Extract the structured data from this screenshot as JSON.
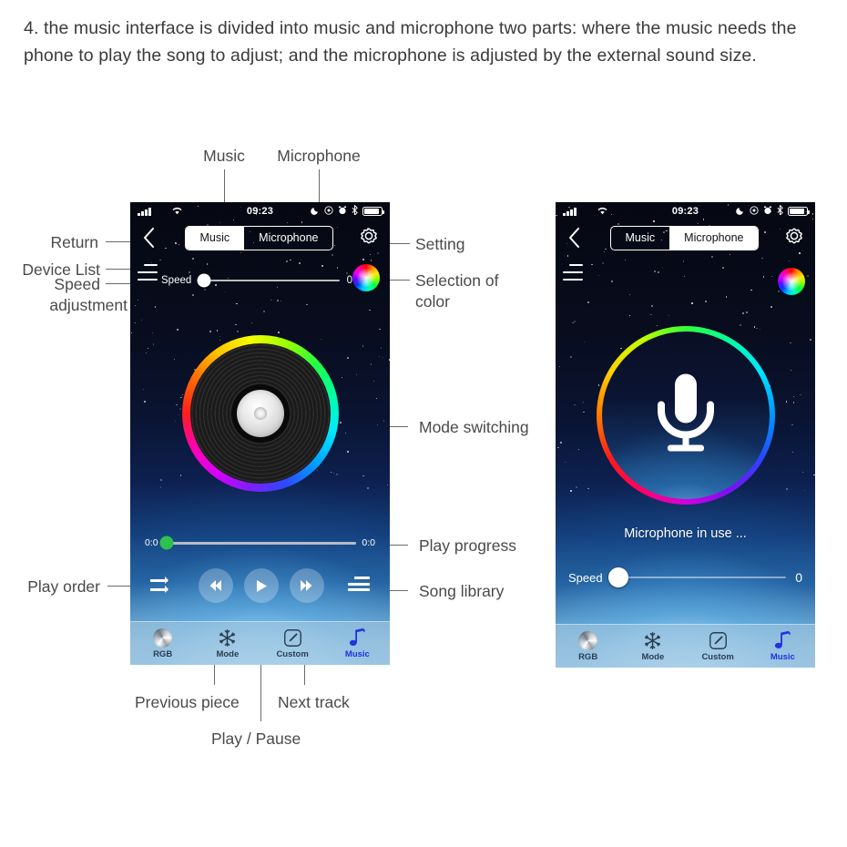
{
  "intro": {
    "text": "4. the music interface is divided into music and microphone two parts: where the music needs the phone to play the song to adjust; and the microphone is adjusted by the external sound size."
  },
  "annotations": {
    "music": "Music",
    "microphone": "Microphone",
    "return": "Return",
    "device_list": "Device List",
    "speed_adjustment_line1": "Speed",
    "speed_adjustment_line2": "adjustment",
    "setting": "Setting",
    "selection_of_color_line1": "Selection of",
    "selection_of_color_line2": "color",
    "mode_switching": "Mode switching",
    "play_progress": "Play progress",
    "play_order": "Play order",
    "song_library": "Song library",
    "previous_piece": "Previous piece",
    "next_track": "Next track",
    "play_pause": "Play / Pause"
  },
  "phone_left": {
    "status": {
      "time": "09:23",
      "icons": [
        "signal-icon",
        "wifi-icon",
        "moon-icon",
        "do-not-disturb-icon",
        "alarm-icon",
        "bluetooth-icon",
        "battery-icon"
      ]
    },
    "segmented": {
      "options": [
        "Music",
        "Microphone"
      ],
      "selected": "Music"
    },
    "speed": {
      "label": "Speed",
      "value": "0",
      "thumb_percent": 4
    },
    "progress": {
      "elapsed": "0:0",
      "total": "0:0",
      "percent": 1
    },
    "tabs": [
      {
        "label": "RGB",
        "icon": "rgb-ball-icon",
        "active": false
      },
      {
        "label": "Mode",
        "icon": "snowflake-icon",
        "active": false
      },
      {
        "label": "Custom",
        "icon": "pencil-square-icon",
        "active": false
      },
      {
        "label": "Music",
        "icon": "music-note-icon",
        "active": true
      }
    ],
    "transport": {
      "order_icon": "play-order-icon",
      "prev_icon": "previous-track-icon",
      "play_icon": "play-pause-icon",
      "next_icon": "next-track-icon",
      "library_icon": "song-library-icon"
    }
  },
  "phone_right": {
    "status": {
      "time": "09:23",
      "icons": [
        "signal-icon",
        "wifi-icon",
        "moon-icon",
        "do-not-disturb-icon",
        "alarm-icon",
        "bluetooth-icon",
        "battery-icon"
      ]
    },
    "segmented": {
      "options": [
        "Music",
        "Microphone"
      ],
      "selected": "Microphone"
    },
    "mic_status": "Microphone in use ...",
    "speed": {
      "label": "Speed",
      "value": "0",
      "thumb_percent": 4
    },
    "tabs": [
      {
        "label": "RGB",
        "icon": "rgb-ball-icon",
        "active": false
      },
      {
        "label": "Mode",
        "icon": "snowflake-icon",
        "active": false
      },
      {
        "label": "Custom",
        "icon": "pencil-square-icon",
        "active": false
      },
      {
        "label": "Music",
        "icon": "music-note-icon",
        "active": true
      }
    ]
  },
  "colors": {
    "accent_blue": "#2233dd",
    "progress_green": "#2fc14e",
    "text_gray": "#4a4a4a"
  }
}
